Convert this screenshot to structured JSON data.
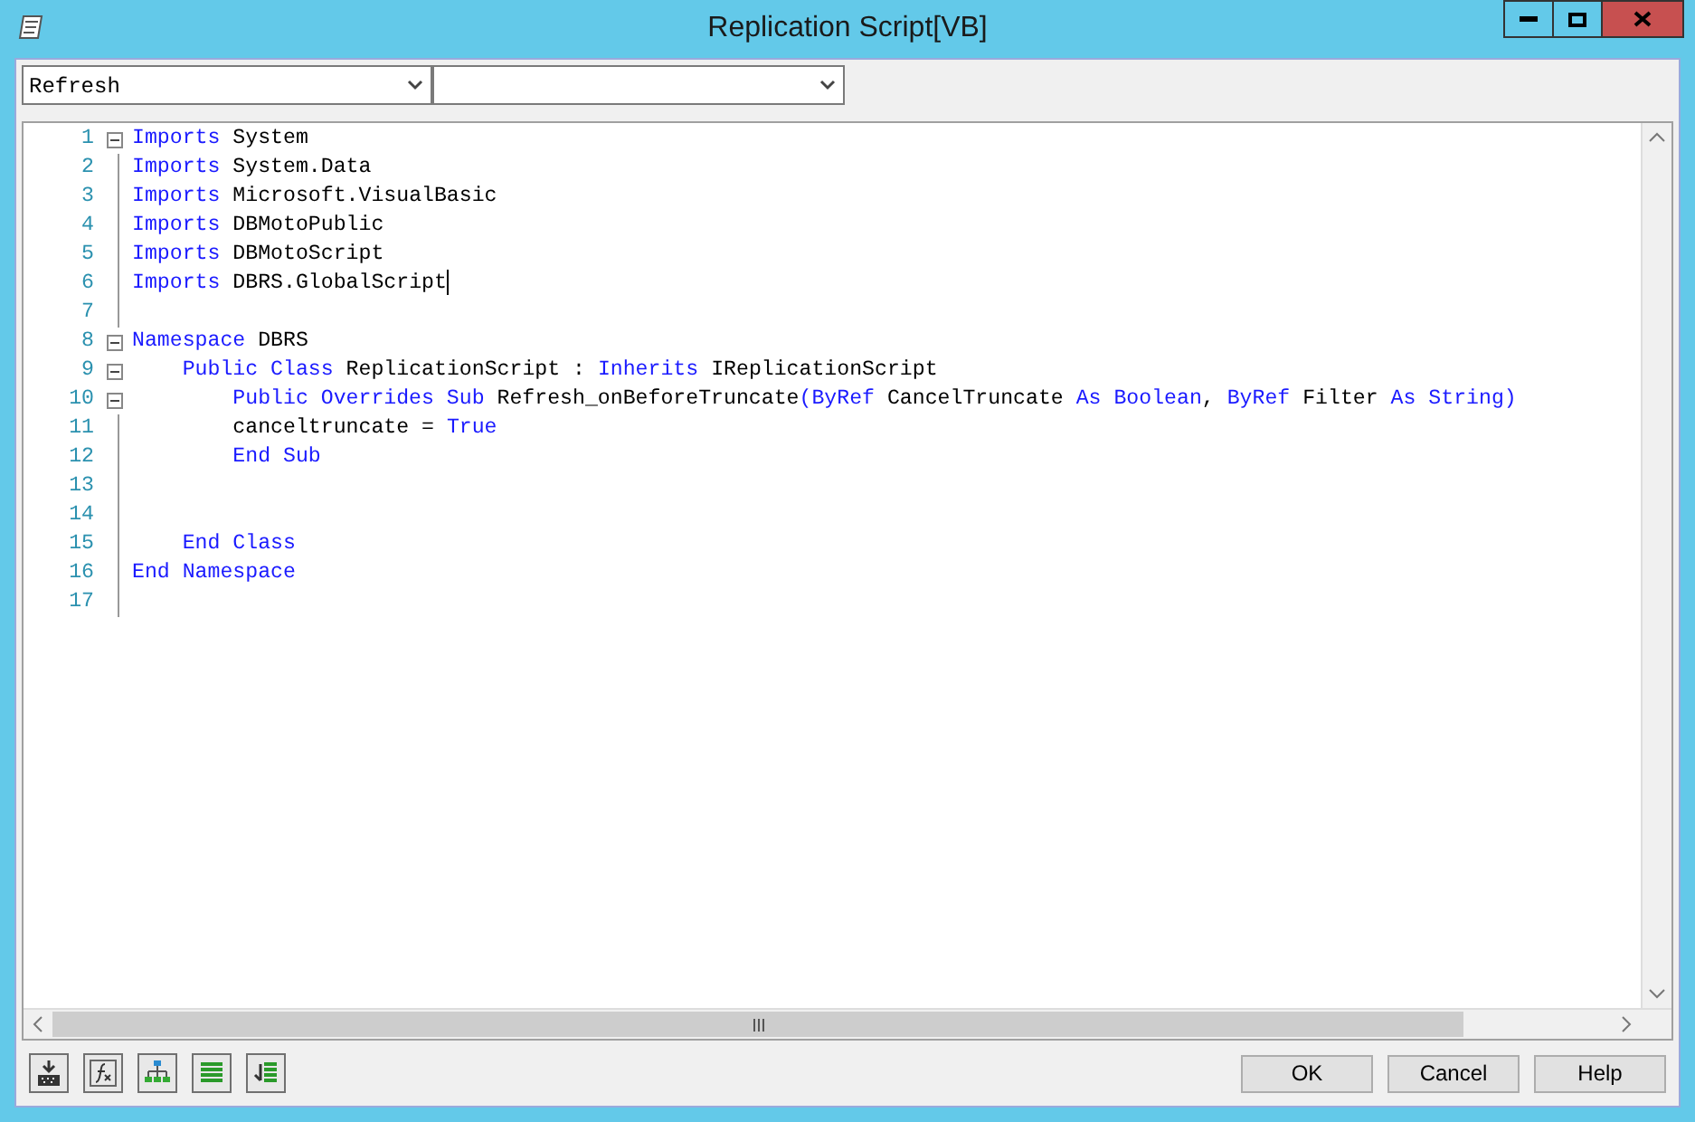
{
  "window": {
    "title": "Replication Script[VB]"
  },
  "selectors": [
    {
      "value": "Refresh"
    }
  ],
  "editor": {
    "lines": [
      {
        "number": "1",
        "fold": true,
        "cursor": false,
        "tokens": [
          {
            "kind": "keyword",
            "text": "Imports"
          },
          {
            "kind": "plain",
            "text": " System"
          }
        ]
      },
      {
        "number": "2",
        "fold": false,
        "cursor": false,
        "tokens": [
          {
            "kind": "keyword",
            "text": "Imports"
          },
          {
            "kind": "plain",
            "text": " System.Data"
          }
        ]
      },
      {
        "number": "3",
        "fold": false,
        "cursor": false,
        "tokens": [
          {
            "kind": "keyword",
            "text": "Imports"
          },
          {
            "kind": "plain",
            "text": " Microsoft.VisualBasic"
          }
        ]
      },
      {
        "number": "4",
        "fold": false,
        "cursor": false,
        "tokens": [
          {
            "kind": "keyword",
            "text": "Imports"
          },
          {
            "kind": "plain",
            "text": " DBMotoPublic"
          }
        ]
      },
      {
        "number": "5",
        "fold": false,
        "cursor": false,
        "tokens": [
          {
            "kind": "keyword",
            "text": "Imports"
          },
          {
            "kind": "plain",
            "text": " DBMotoScript"
          }
        ]
      },
      {
        "number": "6",
        "fold": false,
        "cursor": true,
        "tokens": [
          {
            "kind": "keyword",
            "text": "Imports"
          },
          {
            "kind": "plain",
            "text": " DBRS.GlobalScript"
          }
        ]
      },
      {
        "number": "7",
        "fold": false
      },
      {
        "number": "8",
        "fold": true,
        "cursor": false,
        "tokens": [
          {
            "kind": "keyword",
            "text": "Namespace"
          },
          {
            "kind": "plain",
            "text": " DBRS"
          }
        ]
      },
      {
        "number": "9",
        "fold": true,
        "cursor": false,
        "tokens": [
          {
            "kind": "keyword",
            "text": "    Public Class"
          },
          {
            "kind": "plain",
            "text": " ReplicationScript : "
          },
          {
            "kind": "keyword",
            "text": "Inherits"
          },
          {
            "kind": "plain",
            "text": " IReplicationScript"
          }
        ]
      },
      {
        "number": "10",
        "fold": true,
        "cursor": false,
        "tokens": [
          {
            "kind": "keyword",
            "text": "        Public Overrides Sub"
          },
          {
            "kind": "plain",
            "text": " Refresh_onBeforeTruncate"
          },
          {
            "kind": "keyword",
            "text": "(ByRef"
          },
          {
            "kind": "plain",
            "text": " CancelTruncate "
          },
          {
            "kind": "keyword",
            "text": "As Boolean"
          },
          {
            "kind": "plain",
            "text": ", "
          },
          {
            "kind": "keyword",
            "text": "ByRef"
          },
          {
            "kind": "plain",
            "text": " Filter "
          },
          {
            "kind": "keyword",
            "text": "As String)"
          }
        ]
      },
      {
        "number": "11",
        "fold": false,
        "cursor": false,
        "tokens": [
          {
            "kind": "plain",
            "text": "        canceltruncate = "
          },
          {
            "kind": "keyword",
            "text": "True"
          }
        ]
      },
      {
        "number": "12",
        "fold": false,
        "cursor": false,
        "tokens": [
          {
            "kind": "keyword",
            "text": "        End Sub"
          }
        ]
      },
      {
        "number": "13",
        "fold": false
      },
      {
        "number": "14",
        "fold": false
      },
      {
        "number": "15",
        "fold": false,
        "cursor": false,
        "tokens": [
          {
            "kind": "keyword",
            "text": "    End Class"
          }
        ]
      },
      {
        "number": "16",
        "fold": false,
        "cursor": false,
        "tokens": [
          {
            "kind": "keyword",
            "text": "End Namespace"
          }
        ]
      },
      {
        "number": "17",
        "fold": false
      }
    ]
  },
  "buttons": [
    {
      "label": "OK"
    },
    {
      "label": "Cancel"
    },
    {
      "label": "Help"
    }
  ]
}
